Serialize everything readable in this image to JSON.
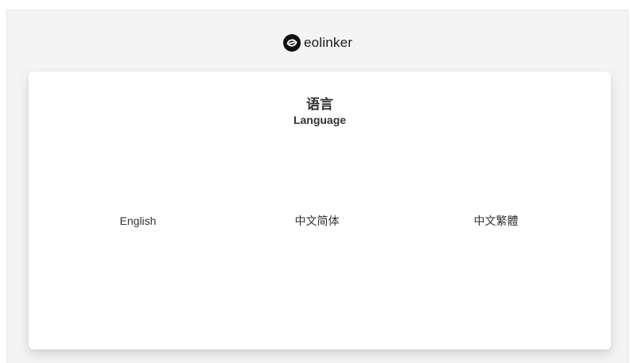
{
  "brand": {
    "name": "eolinker",
    "logo_icon": "eolinker-logo-icon"
  },
  "language_panel": {
    "title_cn": "语言",
    "title_en": "Language",
    "options": [
      {
        "label": "English"
      },
      {
        "label": "中文简体"
      },
      {
        "label": "中文繁體"
      }
    ]
  }
}
